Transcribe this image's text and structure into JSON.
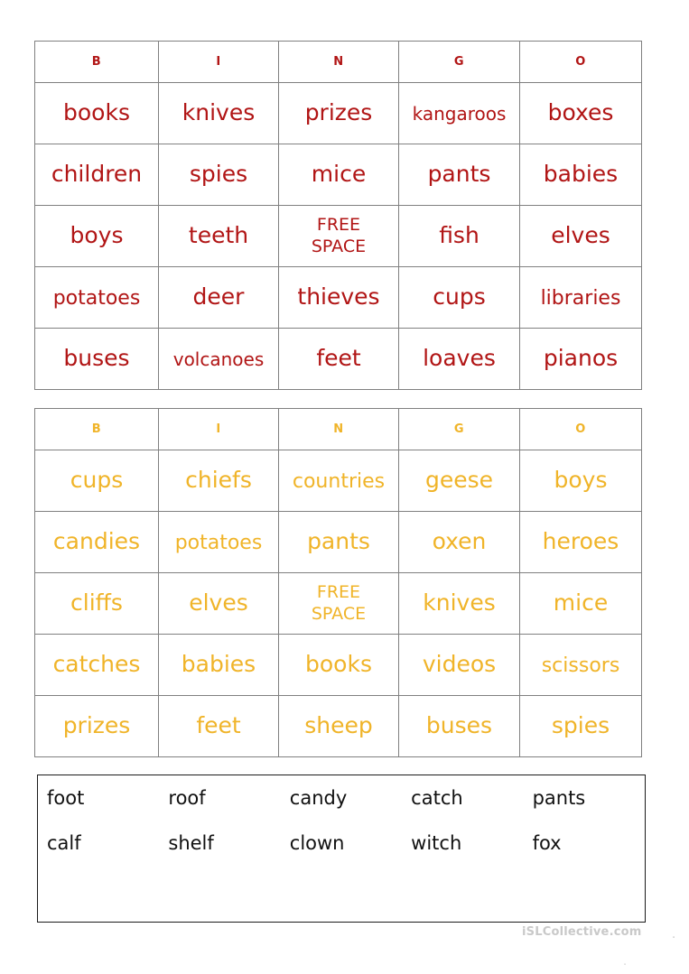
{
  "colors": {
    "card1_text": "#B11515",
    "card2_text": "#F0B429",
    "grid_border": "#808080",
    "wordbank_border": "#1a1a1a",
    "wordbank_text": "#111111",
    "watermark": "#c9c9c9"
  },
  "cards": [
    {
      "id": "card-1",
      "headers": [
        "B",
        "I",
        "N",
        "G",
        "O"
      ],
      "rows": [
        [
          "books",
          "knives",
          "prizes",
          "kangaroos",
          "boxes"
        ],
        [
          "children",
          "spies",
          "mice",
          "pants",
          "babies"
        ],
        [
          "boys",
          "teeth",
          "FREE\nSPACE",
          "fish",
          "elves"
        ],
        [
          "potatoes",
          "deer",
          "thieves",
          "cups",
          "libraries"
        ],
        [
          "buses",
          "volcanoes",
          "feet",
          "loaves",
          "pianos"
        ]
      ]
    },
    {
      "id": "card-2",
      "headers": [
        "B",
        "I",
        "N",
        "G",
        "O"
      ],
      "rows": [
        [
          "cups",
          "chiefs",
          "countries",
          "geese",
          "boys"
        ],
        [
          "candies",
          "potatoes",
          "pants",
          "oxen",
          "heroes"
        ],
        [
          "cliffs",
          "elves",
          "FREE\nSPACE",
          "knives",
          "mice"
        ],
        [
          "catches",
          "babies",
          "books",
          "videos",
          "scissors"
        ],
        [
          "prizes",
          "feet",
          "sheep",
          "buses",
          "spies"
        ]
      ]
    }
  ],
  "word_bank": {
    "rows": [
      [
        "foot",
        "roof",
        "candy",
        "catch",
        "pants"
      ],
      [
        "calf",
        "shelf",
        "clown",
        "witch",
        "fox"
      ]
    ]
  },
  "watermark": {
    "text": "iSLCollective.com",
    "mark_right": ".",
    "mark_bottom": "."
  }
}
